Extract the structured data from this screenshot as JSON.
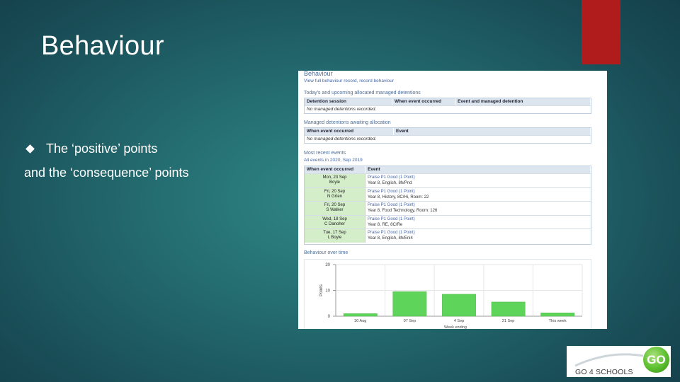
{
  "slide": {
    "title": "Behaviour",
    "bullet": "The ‘positive’ points",
    "line2": "and the ‘consequence’ points"
  },
  "screenshot": {
    "heading": "Behaviour",
    "view_link": "View full behaviour record, record behaviour",
    "today_section": "Today's and upcoming allocated managed detentions",
    "today_headers": [
      "Detention session",
      "When event occurred",
      "Event and managed detention"
    ],
    "today_empty": "No managed detentions recorded.",
    "awaiting_section": "Managed detentions awaiting allocation",
    "awaiting_headers": [
      "When event occurred",
      "Event"
    ],
    "awaiting_empty": "No managed detentions recorded.",
    "recent_section": "Most recent events",
    "recent_link": "All events in 2020, Sep 2019",
    "recent_headers": [
      "When event occurred",
      "Event"
    ],
    "events": [
      {
        "when": "Mon, 23 Sep",
        "who": "Boyle",
        "title": "Praise P1 Good (1 Point)",
        "detail": "Year 8, English, 8h/Pnd"
      },
      {
        "when": "Fri, 20 Sep",
        "who": "N Grten",
        "title": "Praise P1 Good (1 Point)",
        "detail": "Year 8, History, 8C/Hi, Room: 22"
      },
      {
        "when": "Fri, 20 Sep",
        "who": "S Walker",
        "title": "Praise P1 Good (1 Point)",
        "detail": "Year 8, Food Technology, Room: 126"
      },
      {
        "when": "Wed, 18 Sep",
        "who": "C Danoher",
        "title": "Praise P1 Good (1 Point)",
        "detail": "Year 8, RE, 8C/Re"
      },
      {
        "when": "Tue, 17 Sep",
        "who": "L Boyle",
        "title": "Praise P1 Good (1 Point)",
        "detail": "Year 8, English, 8h/Eni4"
      }
    ],
    "chart_section": "Behaviour over time"
  },
  "chart_data": {
    "type": "bar",
    "title": "",
    "categories": [
      "30 Aug",
      "07 Sep",
      "4 Sep",
      "21 Sep",
      "This week"
    ],
    "values": [
      1,
      9.5,
      8.5,
      5.5,
      1.3
    ],
    "ylabel": "Points",
    "xlabel": "Week ending",
    "ylim": [
      0,
      20
    ],
    "yticks": [
      0,
      10,
      20
    ],
    "bar_color": "#5fd45a",
    "grid": true
  },
  "logo": {
    "text": "GO 4 SCHOOLS",
    "badge": "GO"
  },
  "colors": {
    "accent_red": "#b01b1b",
    "link_blue": "#4466aa",
    "event_green": "#d4eec9"
  }
}
